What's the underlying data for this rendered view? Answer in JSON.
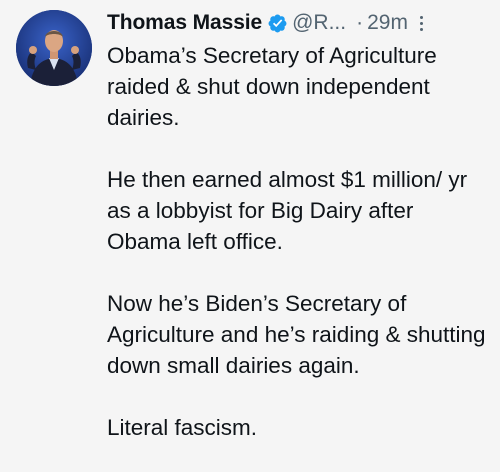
{
  "tweet": {
    "author": {
      "display_name": "Thomas Massie",
      "handle": "@R...",
      "verified": true,
      "avatar_icon": "profile-photo",
      "verified_icon": "verified-badge-icon",
      "verified_color": "#1d9bf0"
    },
    "separator": "·",
    "timestamp": "29m",
    "more_icon": "more-vertical-icon",
    "paragraphs": [
      "Obama’s Secretary of Agriculture raided & shut down independent dairies.",
      "He then earned almost $1 million/ yr as a lobbyist for Big Dairy after Obama left office.",
      "Now he’s Biden’s Secretary of Agriculture and he’s raiding & shutting down small dairies again.",
      "Literal fascism."
    ]
  }
}
